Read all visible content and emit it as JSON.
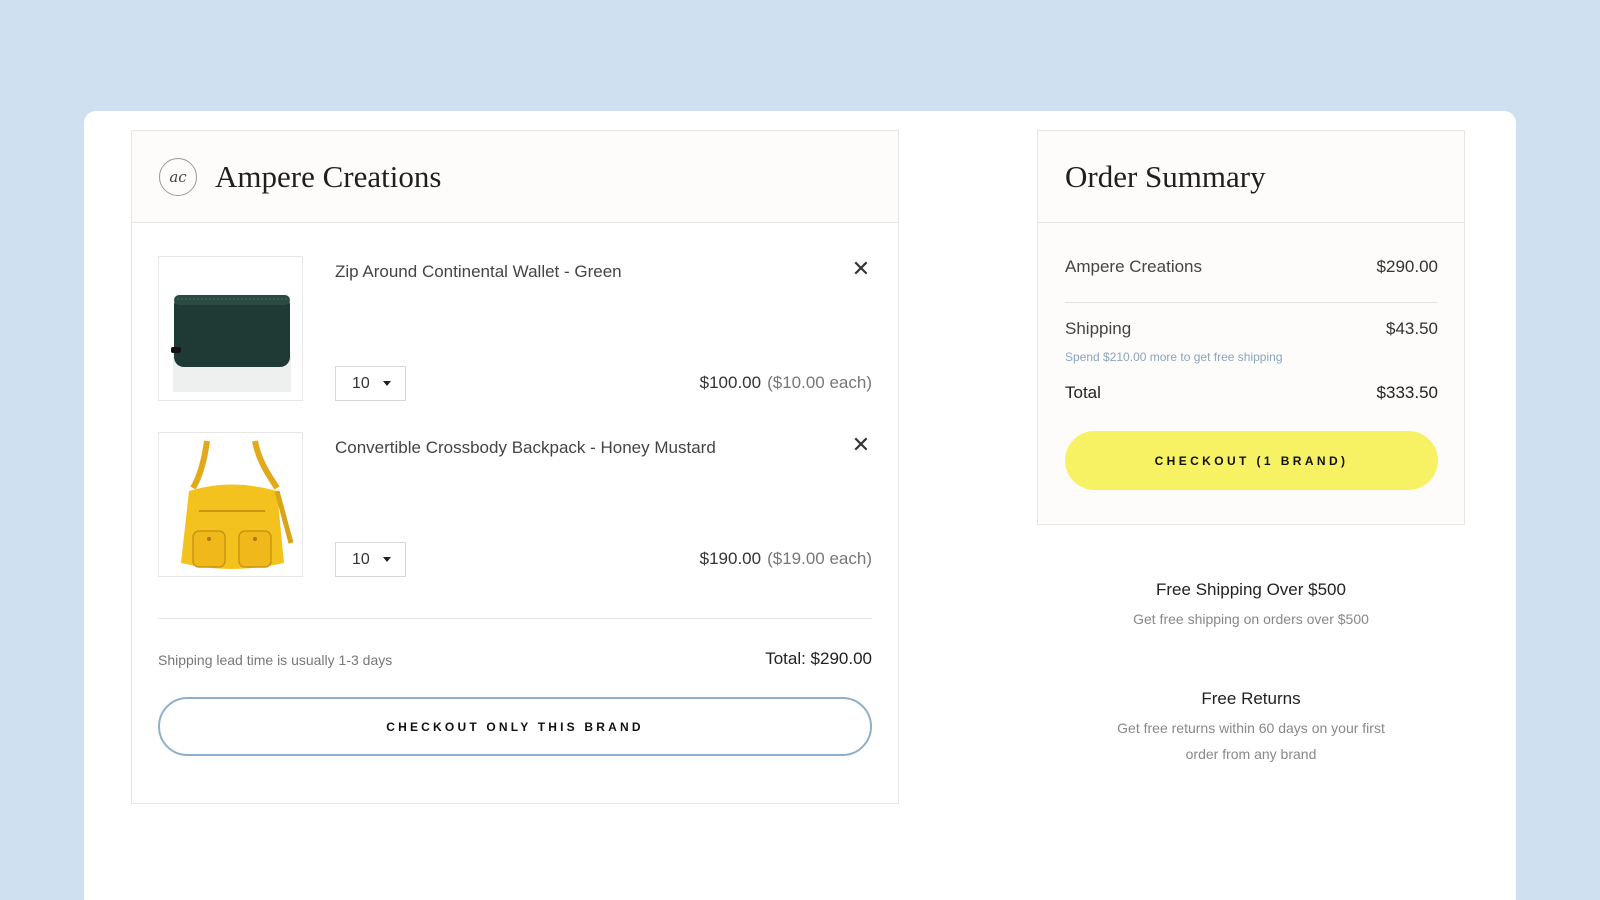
{
  "brand": {
    "name": "Ampere Creations",
    "logo_text": "ac",
    "items": [
      {
        "title": "Zip Around Continental Wallet - Green",
        "quantity": "10",
        "line_total": "$100.00",
        "unit_price": "($10.00 each)",
        "image_icon": "green-wallet-icon"
      },
      {
        "title": "Convertible Crossbody Backpack - Honey Mustard",
        "quantity": "10",
        "line_total": "$190.00",
        "unit_price": "($19.00 each)",
        "image_icon": "yellow-bag-icon"
      }
    ],
    "remove_glyph": "✕",
    "lead_time": "Shipping lead time is usually 1-3 days",
    "total": "Total: $290.00",
    "checkout_label": "CHECKOUT ONLY THIS BRAND"
  },
  "summary": {
    "title": "Order Summary",
    "brand_label": "Ampere Creations",
    "brand_amount": "$290.00",
    "shipping_label": "Shipping",
    "shipping_amount": "$43.50",
    "shipping_note": "Spend $210.00 more to get free shipping",
    "total_label": "Total",
    "total_amount": "$333.50",
    "checkout_label": "CHECKOUT (1 BRAND)"
  },
  "perks": [
    {
      "title": "Free Shipping Over $500",
      "description": "Get free shipping on orders over $500"
    },
    {
      "title": "Free Returns",
      "description_line1": "Get free returns within 60 days on your first",
      "description_line2": "order from any brand"
    }
  ],
  "colors": {
    "page_background": "#cfe0f0",
    "checkout_button": "#f7f164",
    "outline_button_border": "#8fb0cb",
    "shipping_note": "#8aa4be"
  }
}
